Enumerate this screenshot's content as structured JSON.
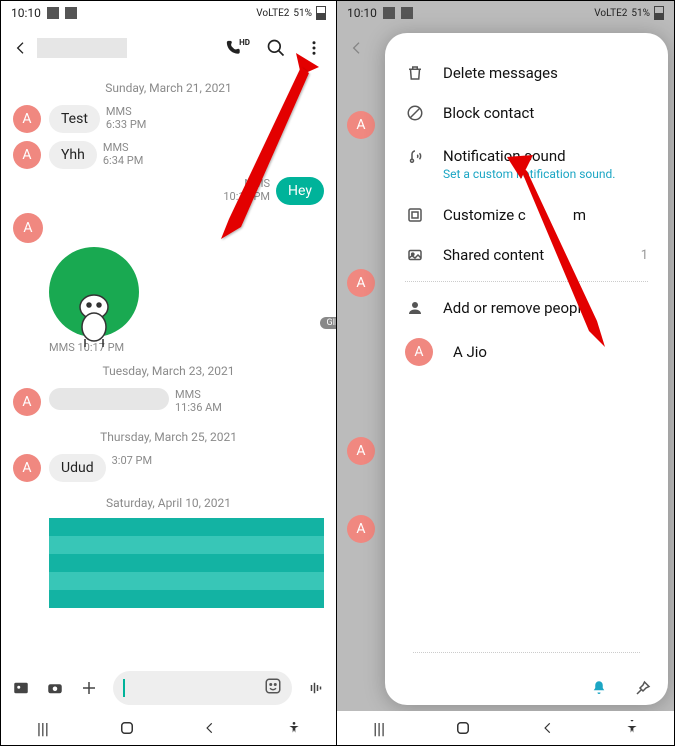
{
  "status": {
    "time": "10:10",
    "net_label": "VoLTE2",
    "battery": "51%"
  },
  "chat": {
    "avatar_letter": "A",
    "dates": {
      "d1": "Sunday, March 21, 2021",
      "d2": "Tuesday, March 23, 2021",
      "d3": "Thursday, March 25, 2021",
      "d4": "Saturday, April 10, 2021"
    },
    "m1": {
      "text": "Test",
      "type": "MMS",
      "time": "6:33 PM"
    },
    "m2": {
      "text": "Yhh",
      "type": "MMS",
      "time": "6:34 PM"
    },
    "m3": {
      "text": "Hey",
      "type": "MMS",
      "time": "10:17 PM"
    },
    "sticker": {
      "type": "MMS",
      "time": "10:17 PM",
      "badge": "GIF"
    },
    "m4": {
      "type": "MMS",
      "time": "11:36 AM"
    },
    "m5": {
      "text": "Udud",
      "time": "3:07 PM"
    }
  },
  "menu": {
    "delete": "Delete messages",
    "block": "Block contact",
    "notif": "Notification sound",
    "notif_sub": "Set a custom notification sound.",
    "customize": "Customize chat room",
    "shared": "Shared content",
    "shared_count": "1",
    "add_people": "Add or remove people",
    "person": {
      "letter": "A",
      "name": "A Jio"
    }
  },
  "customize_partial": "Customize c"
}
